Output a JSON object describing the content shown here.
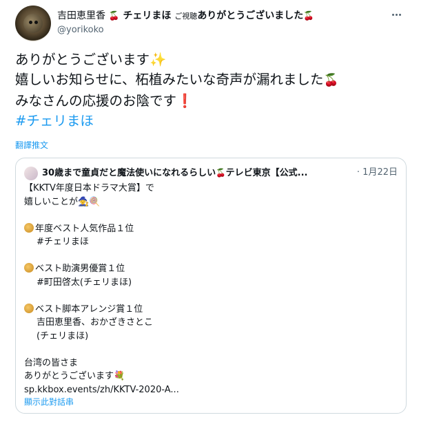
{
  "author": {
    "name": "吉田恵里香",
    "name_suffix_1": "チェリまほ",
    "name_suffix_small": "ご視聴",
    "name_suffix_2": "ありがとうございました",
    "handle": "@yorikoko"
  },
  "tweet": {
    "line1": "ありがとうございます",
    "line2": "嬉しいお知らせに、柘植みたいな奇声が漏れました",
    "line3": "みなさんの応援のお陰です",
    "hashtag": "#チェリまほ",
    "translate_label": "翻譯推文"
  },
  "quote": {
    "name": "30歳まで童貞だと魔法使いになれるらしい",
    "name_suffix": "テレビ東京【公式...",
    "date": "· 1月22日",
    "lines": {
      "l1": "【KKTV年度日本ドラマ大賞】で",
      "l2": "嬉しいことが",
      "l3": "年度ベスト人気作品１位",
      "l4": "#チェリまほ",
      "l5": "ベスト助演男優賞１位",
      "l6": "#町田啓太(チェリまほ)",
      "l7": "ベスト脚本アレンジ賞１位",
      "l8": "吉田恵里香、おかざきさとこ",
      "l9": "(チェリまほ)",
      "l10": "台湾の皆さま",
      "l11": "ありがとうございます",
      "l12": "sp.kkbox.events/zh/KKTV-2020-A..."
    },
    "show_thread": "顯示此對話串"
  },
  "icons": {
    "more": "more-horizontal-icon",
    "cherry": "cherry-emoji",
    "sparkles": "sparkles-emoji",
    "exclamation": "red-exclamation-emoji",
    "medal": "medal-emoji",
    "bouquet": "bouquet-emoji"
  }
}
